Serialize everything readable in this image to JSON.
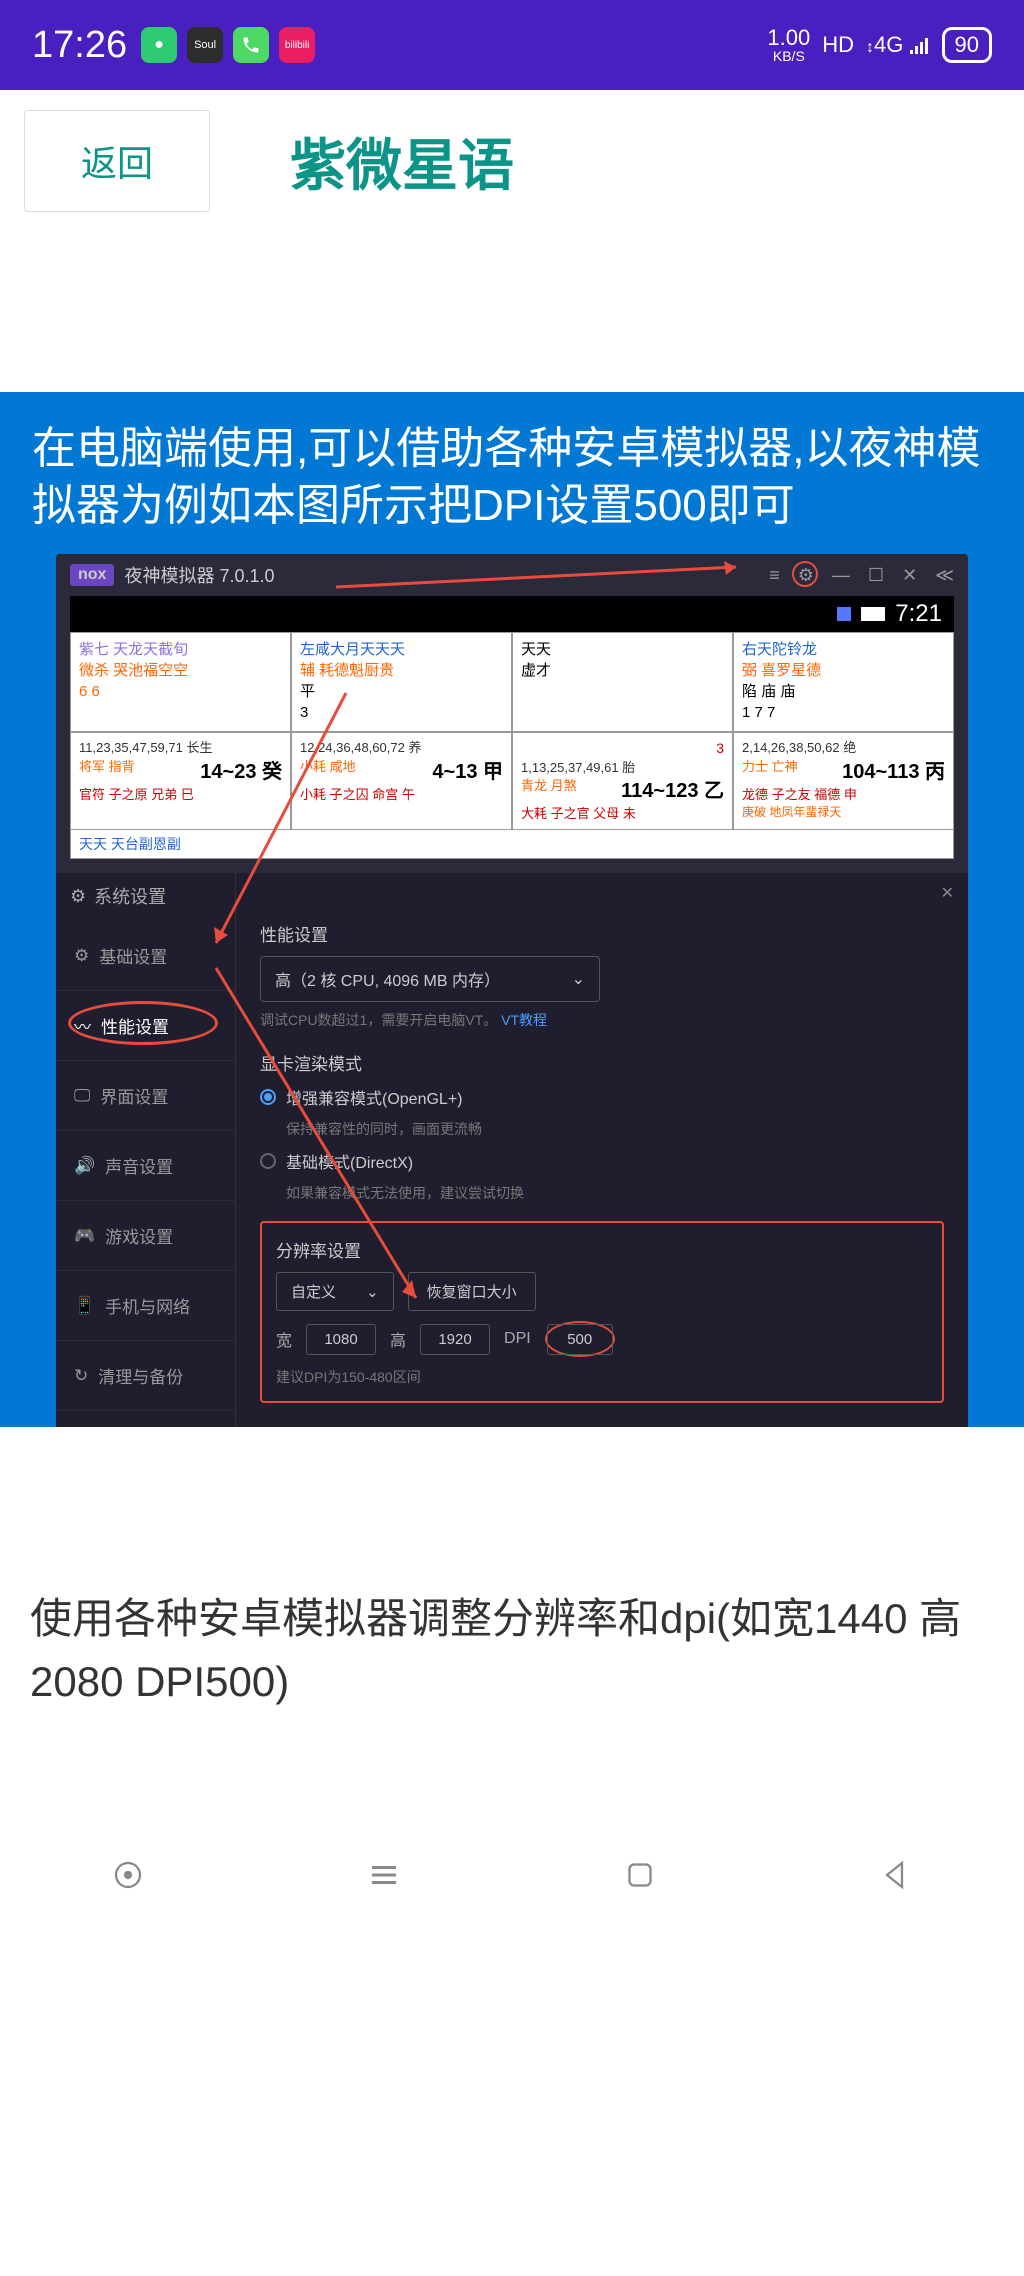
{
  "status": {
    "time": "17:26",
    "kbps_val": "1.00",
    "kbps_unit": "KB/S",
    "hd": "HD",
    "net": "4G",
    "battery": "90"
  },
  "header": {
    "back": "返回",
    "title": "紫微星语"
  },
  "blue_text": "在电脑端使用,可以借助各种安卓模拟器,以夜神模拟器为例如本图所示把DPI设置500即可",
  "nox": {
    "title": "夜神模拟器 7.0.1.0",
    "emu_time": "7:21"
  },
  "chart": {
    "r1": [
      {
        "t": "紫七 天龙天截旬",
        "s": "微杀 哭池福空空",
        "n": "6 6"
      },
      {
        "t": "左咸大月天天天",
        "s": "辅 耗德魁厨贵",
        "m": "平",
        "n": "3"
      },
      {
        "t": "天天",
        "s": "虚才"
      },
      {
        "t": "右天陀铃龙",
        "s": "弼 喜罗星德",
        "m": "陷 庙 庙",
        "n": "1   7 7"
      }
    ],
    "r1b": "天天 天台副恩副",
    "r2": [
      {
        "n": "11,23,35,47,59,71 长生",
        "a": "14~23  癸",
        "b": "将军 指背",
        "c": "官符  子之原  兄弟  巳"
      },
      {
        "n": "12,24,36,48,60,72   养",
        "a": "4~13  甲",
        "b": "小耗 咸地",
        "c": "小耗  子之囚  命宫  午"
      },
      {
        "n": "1,13,25,37,49,61   胎",
        "a": "114~123  乙",
        "b": "青龙 月煞",
        "c": "大耗  子之官  父母  未",
        "r": "3"
      },
      {
        "n": "2,14,26,38,50,62   绝",
        "a": "104~113  丙",
        "b": "力士 亡神",
        "c": "龙德  子之友  福德  申",
        "d": "庚破 地凤年蜚禄天"
      }
    ]
  },
  "settings": {
    "title": "系统设置",
    "sidebar": [
      "基础设置",
      "性能设置",
      "界面设置",
      "声音设置",
      "游戏设置",
      "手机与网络",
      "清理与备份"
    ],
    "perf_label": "性能设置",
    "perf_value": "高（2 核 CPU, 4096 MB 内存）",
    "perf_hint_a": "调试CPU数超过1，需要开启电脑VT。",
    "perf_hint_link": "VT教程",
    "gpu_label": "显卡渲染模式",
    "gpu_opt1": "增强兼容模式(OpenGL+)",
    "gpu_hint1": "保持兼容性的同时，画面更流畅",
    "gpu_opt2": "基础模式(DirectX)",
    "gpu_hint2": "如果兼容模式无法使用，建议尝试切换",
    "res_label": "分辨率设置",
    "res_select": "自定义",
    "res_restore": "恢复窗口大小",
    "res_w_label": "宽",
    "res_w": "1080",
    "res_h_label": "高",
    "res_h": "1920",
    "res_dpi_label": "DPI",
    "res_dpi": "500",
    "res_hint": "建议DPI为150-480区间"
  },
  "bottom_text": "使用各种安卓模拟器调整分辨率和dpi(如宽1440 高2080 DPI500)"
}
